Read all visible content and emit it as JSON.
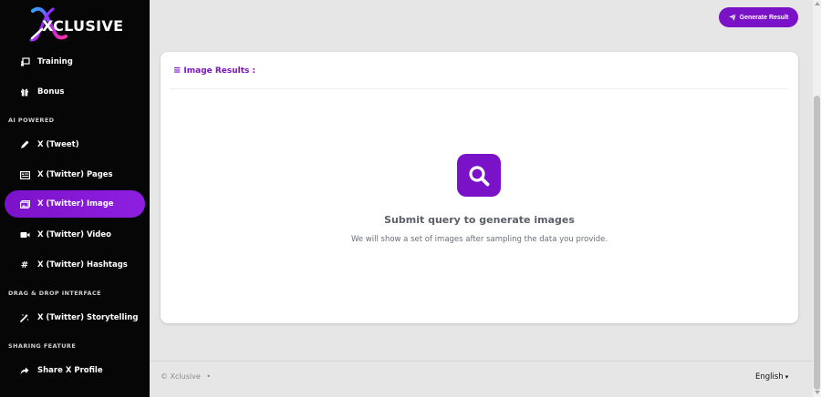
{
  "app": {
    "logo_text": "XCLUSIVE",
    "brand_color": "#7a12c8"
  },
  "sidebar": {
    "items_top": [
      {
        "label": "Training",
        "icon": "training-icon"
      },
      {
        "label": "Bonus",
        "icon": "gift-icon"
      }
    ],
    "section_ai": "AI POWERED",
    "items_ai": [
      {
        "label": "X (Tweet)",
        "icon": "pencil-icon"
      },
      {
        "label": "X (Twitter) Pages",
        "icon": "pages-icon"
      },
      {
        "label": "X (Twitter) Image",
        "icon": "image-icon",
        "active": true
      },
      {
        "label": "X (Twitter) Video",
        "icon": "video-icon"
      },
      {
        "label": "X (Twitter) Hashtags",
        "icon": "hashtag-icon"
      }
    ],
    "section_dnd": "DRAG & DROP INTERFACE",
    "items_dnd": [
      {
        "label": "X (Twitter) Storytelling",
        "icon": "magic-wand-icon"
      }
    ],
    "section_share": "SHARING FEATURE",
    "items_share": [
      {
        "label": "Share X Profile",
        "icon": "share-icon"
      }
    ]
  },
  "header": {
    "generate_button": "Generate Result"
  },
  "results": {
    "title": "Image Results :",
    "empty_title": "Submit query to generate images",
    "empty_subtitle": "We will show a set of images after sampling the data you provide."
  },
  "footer": {
    "copyright": "© Xclusive",
    "language": "English"
  }
}
